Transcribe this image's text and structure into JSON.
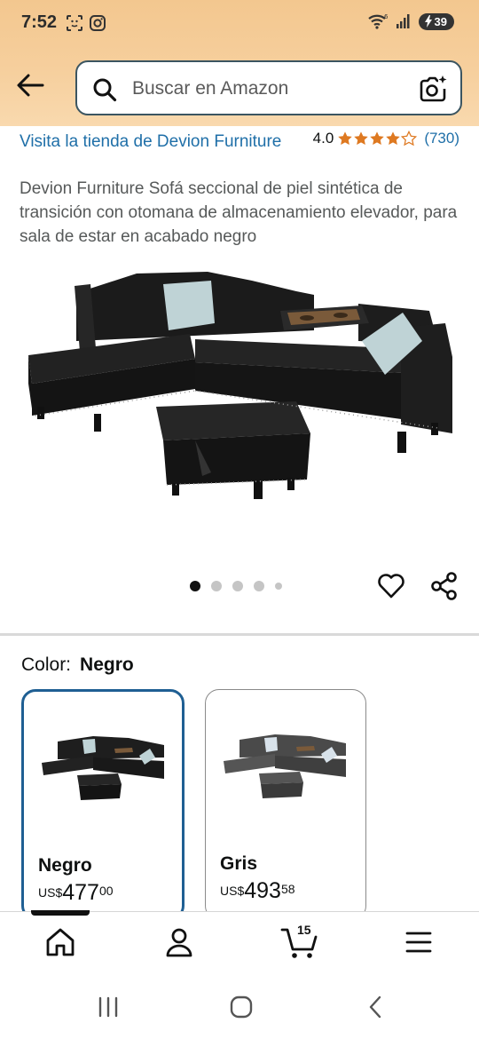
{
  "status": {
    "time": "7:52",
    "battery": "39",
    "wifi_label": "6"
  },
  "search": {
    "placeholder": "Buscar en Amazon"
  },
  "store": {
    "link": "Visita la tienda de Devion Furniture"
  },
  "rating": {
    "value": "4.0",
    "stars": 4,
    "count": "(730)"
  },
  "product": {
    "title": "Devion Furniture Sofá seccional de piel sintética de transición con otomana de almacenamiento elevador, para sala de estar en acabado negro",
    "image_count": 5,
    "active_image": 0
  },
  "color": {
    "label": "Color:",
    "selected": "Negro"
  },
  "swatches": [
    {
      "name": "Negro",
      "currency": "US$",
      "whole": "477",
      "fraction": "00",
      "selected": true,
      "tone": "#1e1e1e"
    },
    {
      "name": "Gris",
      "currency": "US$",
      "whole": "493",
      "fraction": "58",
      "selected": false,
      "tone": "#4a4a4a"
    }
  ],
  "nav": {
    "cart_count": "15",
    "items": [
      "home-icon",
      "account-icon",
      "cart-icon",
      "menu-icon"
    ]
  },
  "colors": {
    "header_top": "#f3c78f",
    "link": "#1f6fa8",
    "star": "#de7921",
    "selected_border": "#1f5f93"
  }
}
